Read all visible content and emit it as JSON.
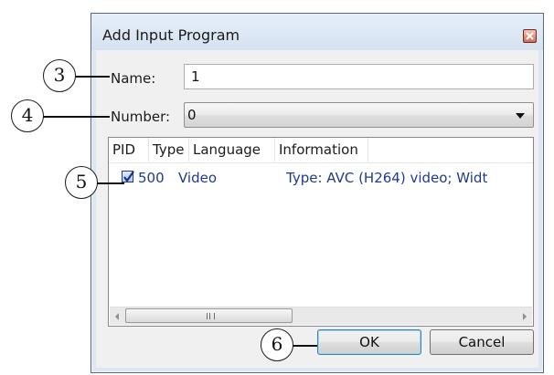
{
  "dialog": {
    "title": "Add Input Program",
    "close_icon": "close-icon"
  },
  "form": {
    "name_label": "Name:",
    "name_value": "1",
    "number_label": "Number:",
    "number_value": "0"
  },
  "list": {
    "columns": [
      "PID",
      "Type",
      "Language",
      "Information"
    ],
    "rows": [
      {
        "checked": true,
        "pid": "500",
        "type": "Video",
        "language": "",
        "information": "Type: AVC (H264) video; Widt"
      }
    ],
    "scrollbar_grip": "III"
  },
  "buttons": {
    "ok": "OK",
    "cancel": "Cancel"
  },
  "callouts": {
    "name": "3",
    "number": "4",
    "checkbox": "5",
    "ok": "6"
  },
  "colors": {
    "dialog_frame": "#dde7f4",
    "list_text": "#1f3a8f",
    "ok_border": "#3c7fb1"
  }
}
